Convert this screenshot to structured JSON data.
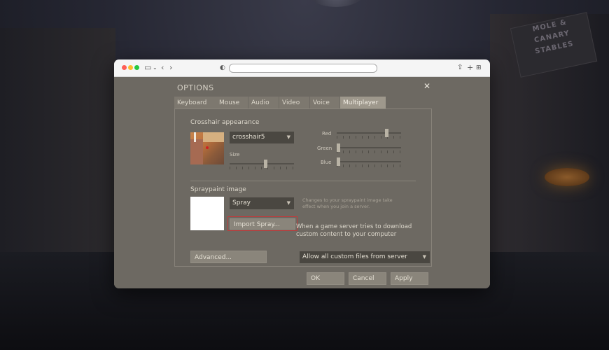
{
  "background": {
    "sign_lines": [
      "MOLE &",
      "CANARY",
      "STABLES"
    ]
  },
  "dialog": {
    "title": "OPTIONS",
    "tabs": [
      {
        "label": "Keyboard"
      },
      {
        "label": "Mouse"
      },
      {
        "label": "Audio"
      },
      {
        "label": "Video"
      },
      {
        "label": "Voice"
      },
      {
        "label": "Multiplayer",
        "active": true
      }
    ],
    "crosshair": {
      "heading": "Crosshair appearance",
      "selected": "crosshair5",
      "size_label": "Size",
      "size_value": 0.55,
      "red_label": "Red",
      "red_value": 0.77,
      "green_label": "Green",
      "green_value": 0.02,
      "blue_label": "Blue",
      "blue_value": 0.02
    },
    "spray": {
      "heading": "Spraypaint image",
      "selected": "Spray",
      "hint": "Changes to your spraypaint image take effect when you join a server.",
      "import_label": "Import Spray..."
    },
    "custom_content": {
      "text_line1": "When a game server tries to download",
      "text_line2": "custom content to your computer",
      "selected": "Allow all custom files from server"
    },
    "advanced_label": "Advanced...",
    "ok_label": "OK",
    "cancel_label": "Cancel",
    "apply_label": "Apply"
  },
  "colors": {
    "dialog_bg": "#6d6962",
    "highlight": "#c23a3a"
  }
}
